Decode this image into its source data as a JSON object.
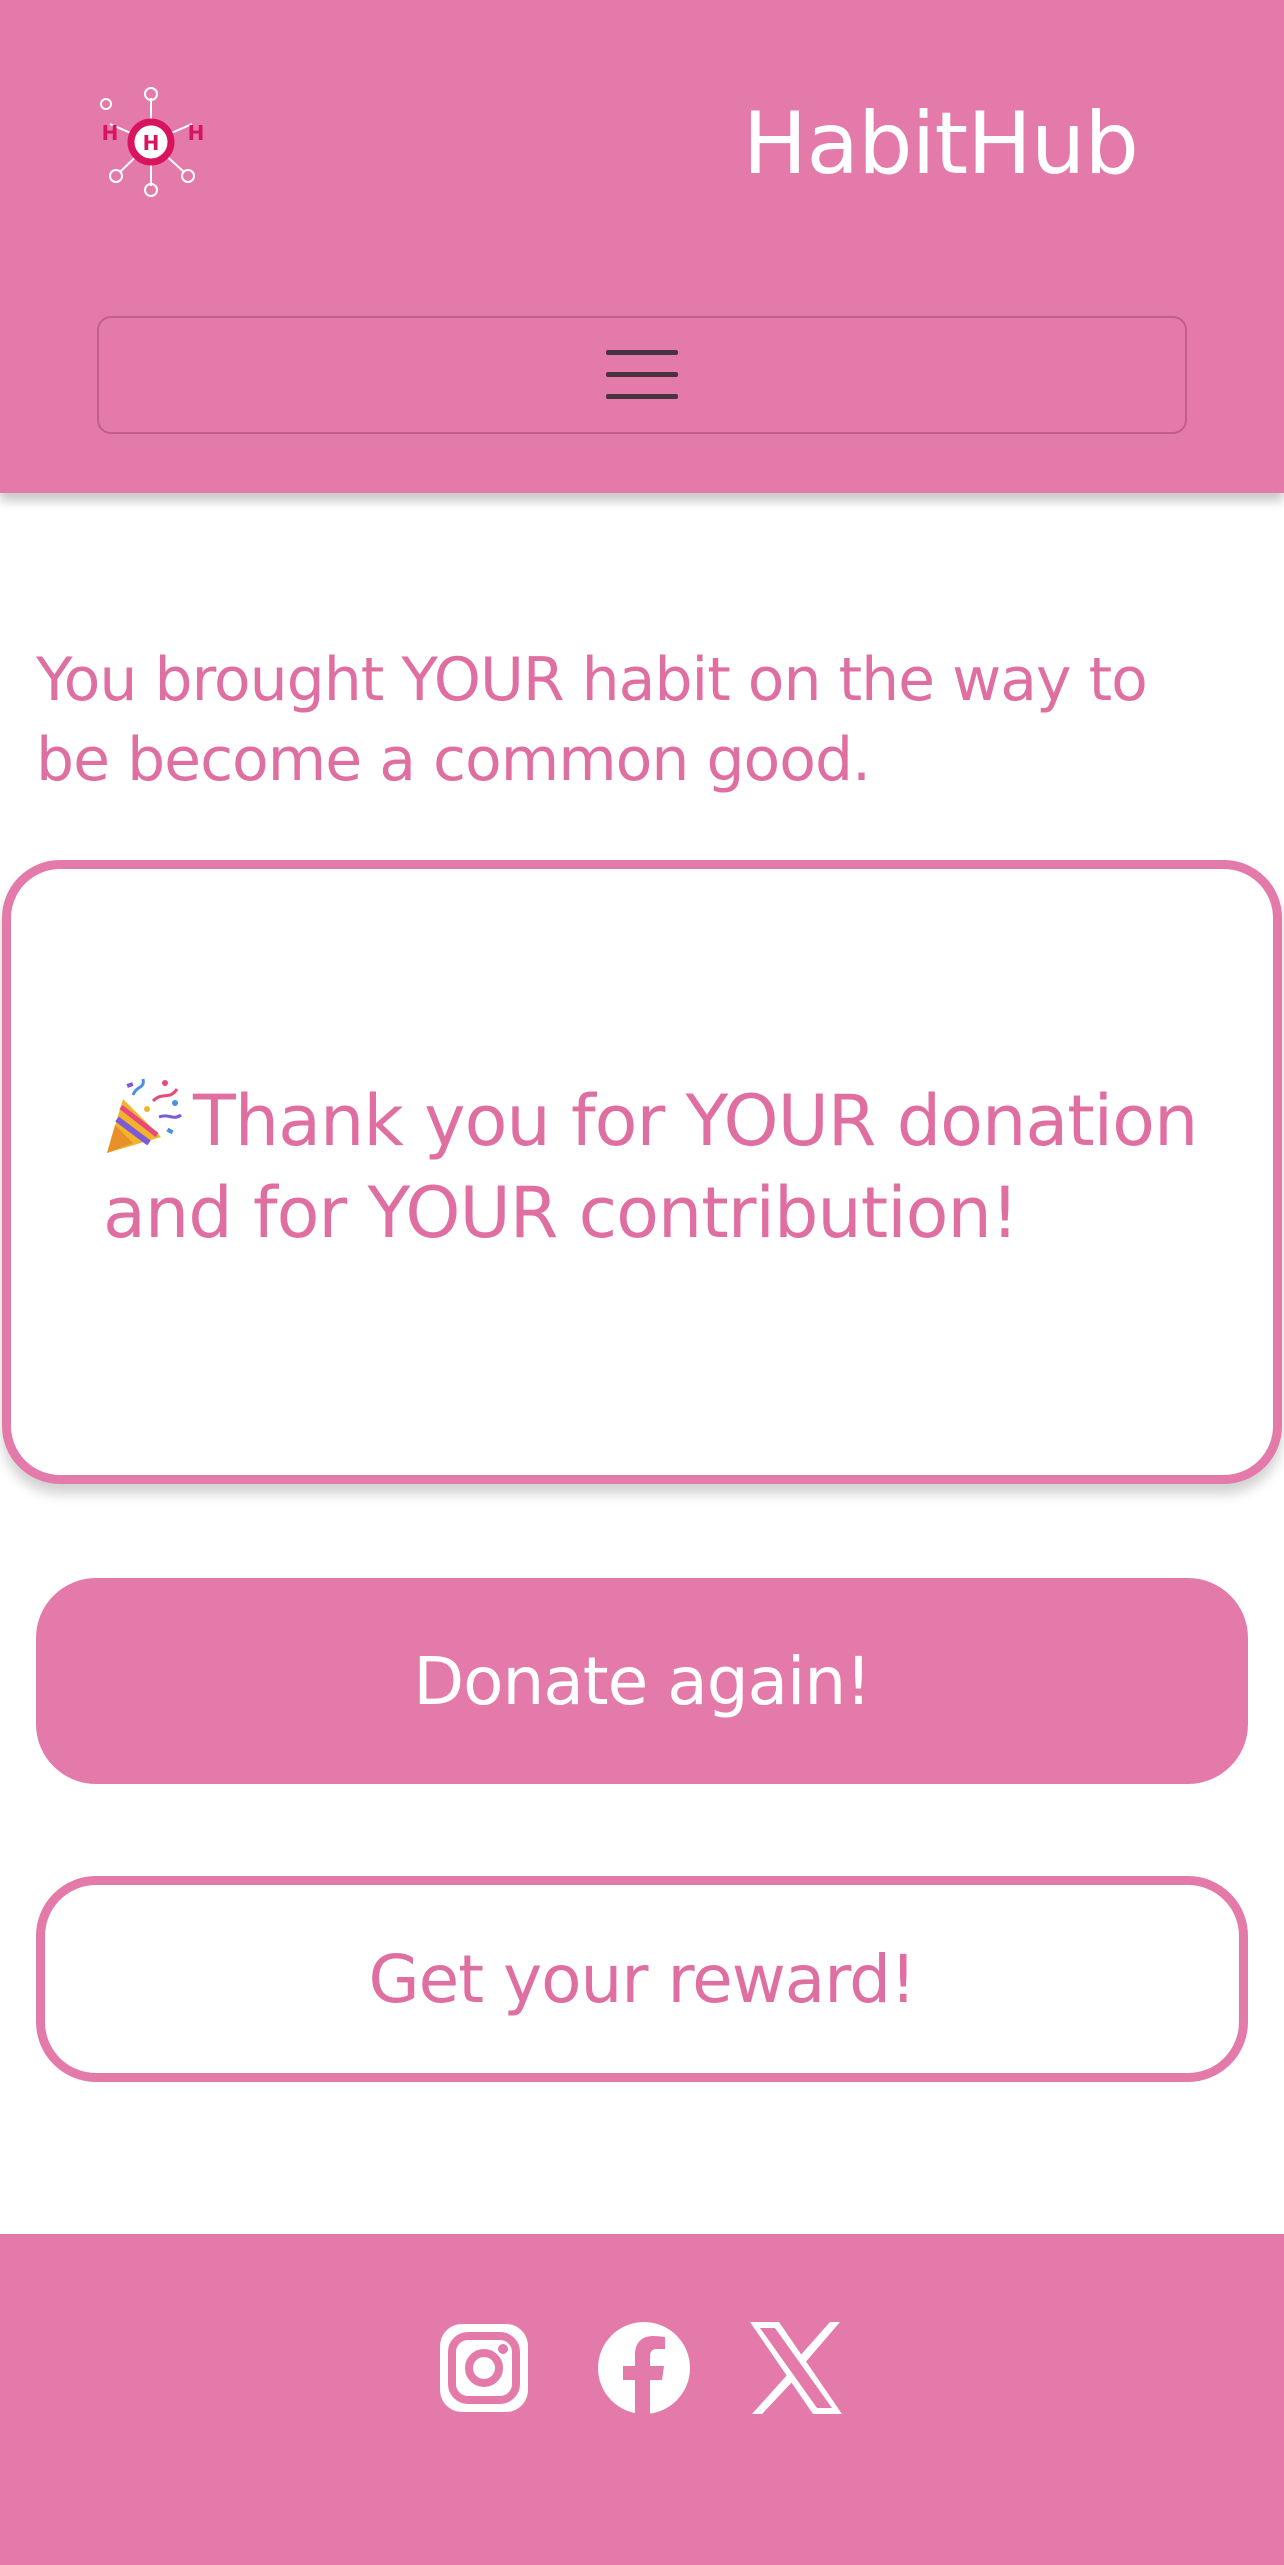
{
  "header": {
    "brand": "HabitHub",
    "logo_letters": [
      "H",
      "H",
      "H"
    ]
  },
  "nav": {
    "toggle_icon": "hamburger-icon"
  },
  "main": {
    "intro": "You brought YOUR habit on the way to be become a common good.",
    "thanks_emoji": "party-popper-icon",
    "thanks": "Thank you for YOUR donation and for YOUR contribution!",
    "donate_button": "Donate again!",
    "reward_button": "Get your reward!"
  },
  "footer": {
    "social_icons": [
      "instagram-icon",
      "facebook-icon",
      "x-icon"
    ]
  },
  "colors": {
    "brand_pink": "#e47aa9",
    "text_pink": "#e06fa1",
    "logo_magenta": "#d8145f",
    "white": "#ffffff"
  }
}
